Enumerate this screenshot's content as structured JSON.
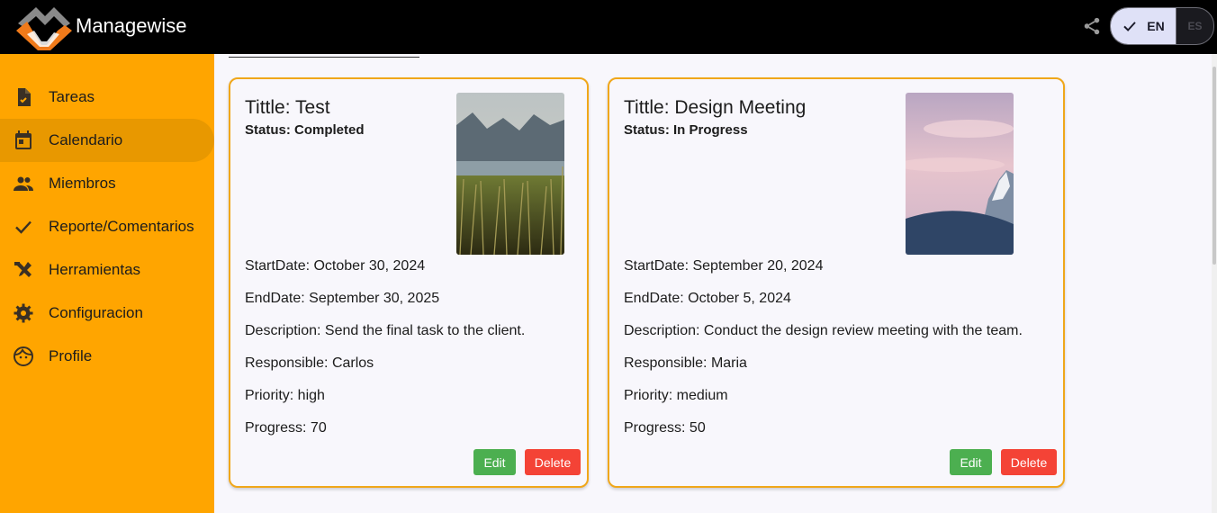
{
  "app": {
    "title": "Managewise"
  },
  "header": {
    "lang_en": "EN",
    "lang_es": "ES",
    "active_language": "EN"
  },
  "colors": {
    "sidebar": "#ffa500",
    "sidebar_active": "#e89800",
    "card_border": "#f0a71a",
    "edit": "#4caf50",
    "delete": "#f44336"
  },
  "sidebar": {
    "active": "Calendario",
    "items": [
      {
        "label": "Tareas",
        "icon": "task-icon"
      },
      {
        "label": "Calendario",
        "icon": "calendar-icon"
      },
      {
        "label": "Miembros",
        "icon": "people-icon"
      },
      {
        "label": "Reporte/Comentarios",
        "icon": "check-icon"
      },
      {
        "label": "Herramientas",
        "icon": "tools-icon"
      },
      {
        "label": "Configuracion",
        "icon": "gear-icon"
      },
      {
        "label": "Profile",
        "icon": "face-icon"
      }
    ]
  },
  "cards": [
    {
      "title": "Tittle: Test",
      "status": "Status: Completed",
      "start": "StartDate: October 30, 2024",
      "end": "EndDate: September 30, 2025",
      "description": "Description: Send the final task to the client.",
      "responsible": "Responsible: Carlos",
      "priority": "Priority: high",
      "progress": "Progress: 70",
      "image": "lake-mountains-photo",
      "edit": "Edit",
      "delete": "Delete"
    },
    {
      "title": "Tittle: Design Meeting",
      "status": "Status: In Progress",
      "start": "StartDate: September 20, 2024",
      "end": "EndDate: October 5, 2024",
      "description": "Description: Conduct the design review meeting with the team.",
      "responsible": "Responsible: Maria",
      "priority": "Priority: medium",
      "progress": "Progress: 50",
      "image": "snowy-mountain-sunset-photo",
      "edit": "Edit",
      "delete": "Delete"
    }
  ]
}
